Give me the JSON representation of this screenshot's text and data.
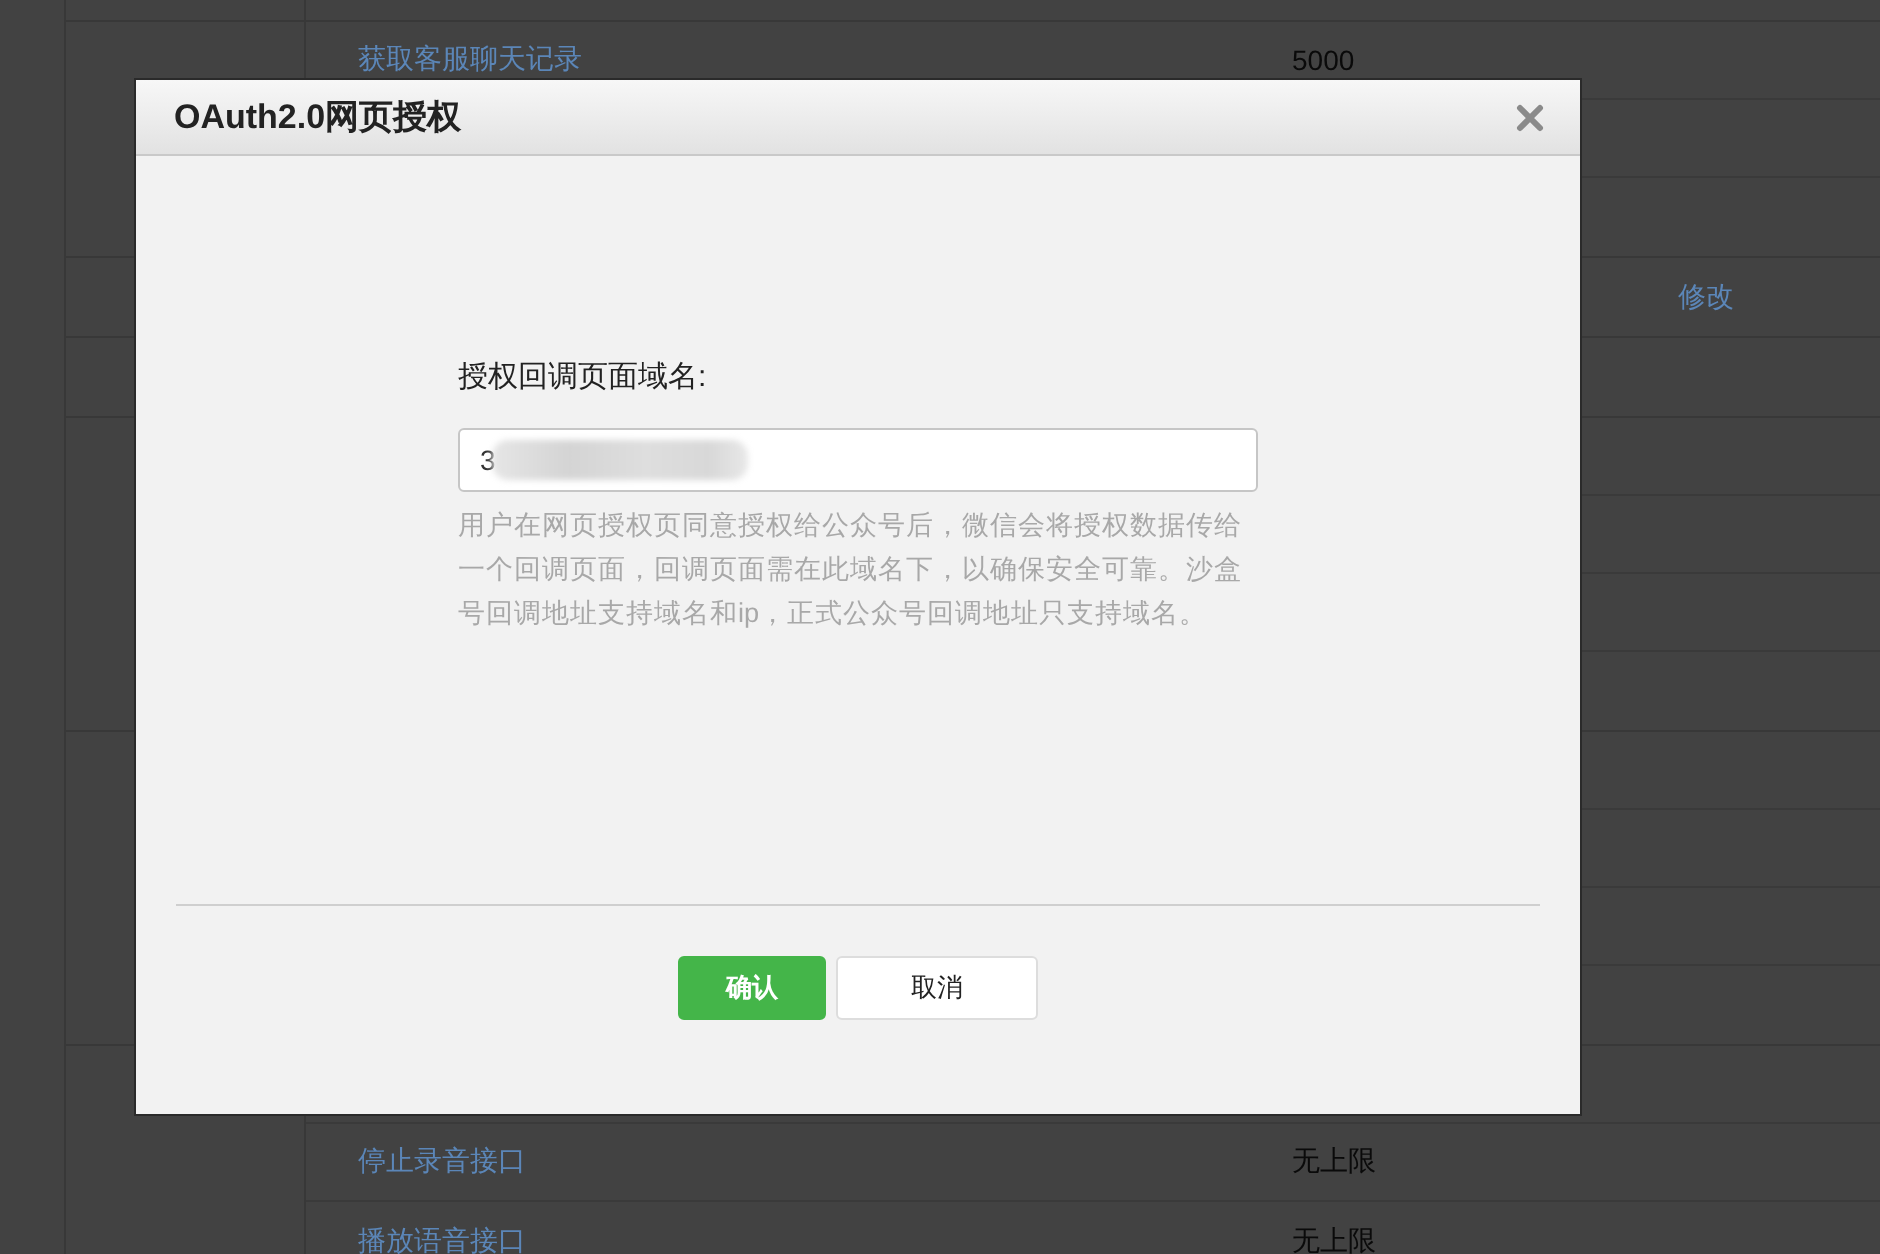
{
  "background_table": {
    "sections": [
      {
        "rows": [
          {}
        ]
      },
      {
        "rows": [
          {
            "api": "获取客服聊天记录",
            "limit": "5000"
          },
          {},
          {}
        ]
      },
      {
        "rows": [
          {
            "action": "修改"
          }
        ]
      },
      {
        "rows": [
          {}
        ]
      },
      {
        "rows": [
          {},
          {},
          {},
          {}
        ]
      },
      {
        "rows": [
          {},
          {},
          {},
          {}
        ]
      },
      {
        "rows": [
          {},
          {
            "api": "停止录音接口",
            "limit": "无上限"
          },
          {
            "api": "播放语音接口",
            "limit": "无上限"
          }
        ]
      }
    ]
  },
  "dialog": {
    "title": "OAuth2.0网页授权",
    "field": {
      "label": "授权回调页面域名:",
      "value": "3",
      "redacted": true
    },
    "hint": "用户在网页授权页同意授权给公众号后，微信会将授权数据传给一个回调页面，回调页面需在此域名下，以确保安全可靠。沙盒号回调地址支持域名和ip，正式公众号回调地址只支持域名。",
    "buttons": [
      {
        "label": "确认",
        "kind": "primary"
      },
      {
        "label": "取消",
        "kind": "default"
      }
    ]
  }
}
